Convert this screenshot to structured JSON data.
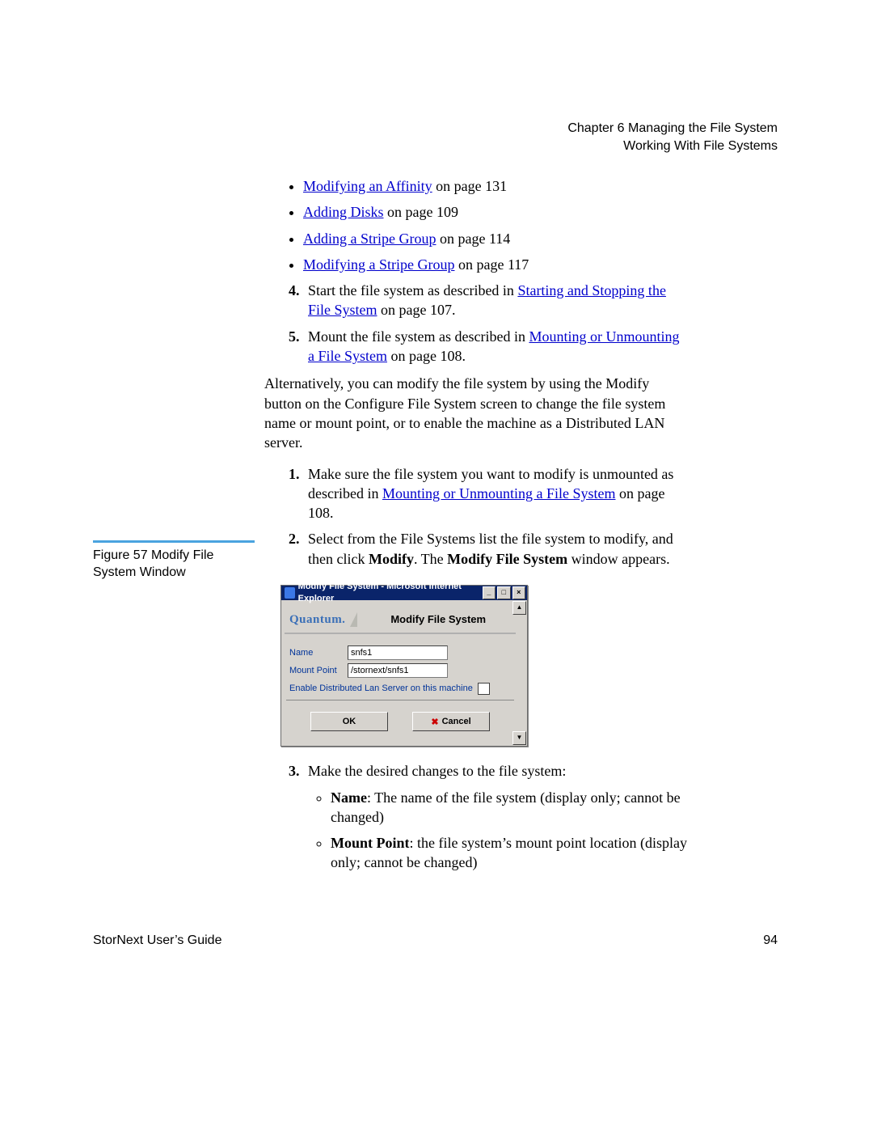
{
  "header": {
    "chapter": "Chapter 6  Managing the File System",
    "section": "Working With File Systems"
  },
  "bullets_top": [
    {
      "link": "Modifying an Affinity",
      "suffix": " on page  131"
    },
    {
      "link": "Adding Disks",
      "suffix": " on page  109"
    },
    {
      "link": "Adding a Stripe Group",
      "suffix": " on page  114"
    },
    {
      "link": "Modifying a Stripe Group",
      "suffix": " on page  117"
    }
  ],
  "steps_a": {
    "s4": {
      "pre": "Start the file system as described in ",
      "link": "Starting and Stopping the File System",
      "post": " on page  107."
    },
    "s5": {
      "pre": "Mount the file system as described in ",
      "link": "Mounting or Unmounting a File System",
      "post": " on page  108."
    }
  },
  "alt_para": "Alternatively, you can modify the file system by using the Modify button on the Configure File System screen to change the file system name or mount point, or to enable the machine as a Distributed LAN server.",
  "steps_b": {
    "s1": {
      "pre": "Make sure the file system you want to modify is unmounted as described in ",
      "link": "Mounting or Unmounting a File System",
      "post": " on page  108."
    },
    "s2": {
      "pre": "Select from the File Systems list the file system to modify, and then click ",
      "bold1": "Modify",
      "mid": ". The ",
      "bold2": "Modify File System",
      "post": " window appears."
    },
    "s3": {
      "intro": "Make the desired changes to the file system:",
      "b1_bold": "Name",
      "b1_rest": ": The name of the file system (display only; cannot be changed)",
      "b2_bold": "Mount Point",
      "b2_rest": ": the file system’s mount point location (display only; cannot be changed)"
    }
  },
  "figure": {
    "caption": "Figure 57  Modify File System Window"
  },
  "dialog": {
    "title": "Modify File System - Microsoft Internet Explorer",
    "brand": "Quantum.",
    "heading": "Modify File System",
    "name_label": "Name",
    "name_value": "snfs1",
    "mount_label": "Mount Point",
    "mount_value": "/stornext/snfs1",
    "checkbox_label": "Enable Distributed Lan Server on this machine",
    "ok": "OK",
    "cancel": "Cancel"
  },
  "footer": {
    "left": "StorNext User’s Guide",
    "right": "94"
  }
}
